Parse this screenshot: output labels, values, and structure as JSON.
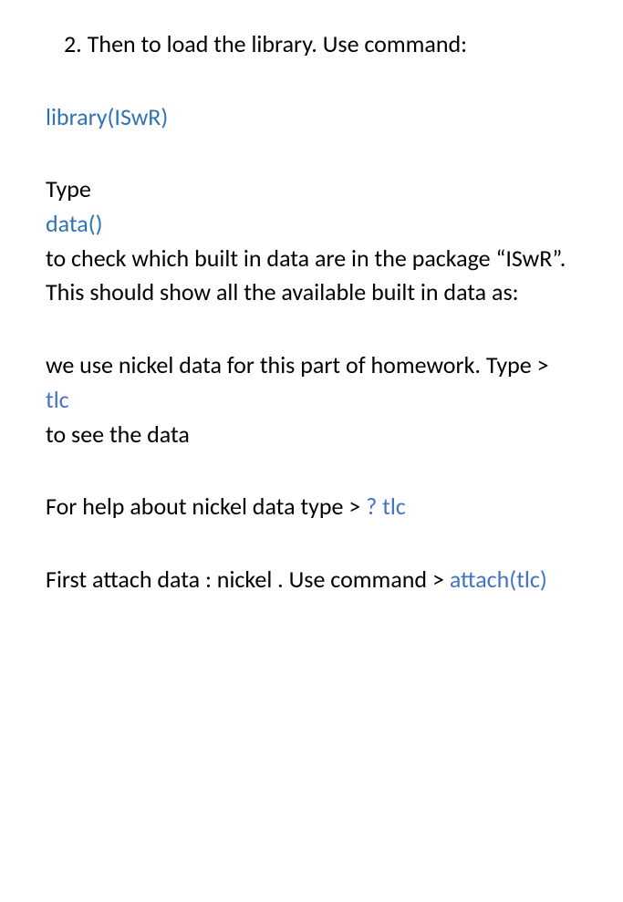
{
  "list": {
    "number": "2.",
    "text": "Then to load the library. Use command:"
  },
  "code": {
    "library": "library(ISwR)",
    "data": "data()",
    "tlc": "tlc",
    "help_tlc": "? tlc",
    "attach_tlc": "attach(tlc)"
  },
  "text": {
    "type_label": "Type",
    "check_builtin": "to check which built in data are in the package “ISwR”.",
    "show_available": "This should show all the available built in data as:",
    "use_nickel_prefix": "we use nickel  data for this part of homework. Type > ",
    "to_see_data": "to see the data",
    "help_prefix": "For help about nickel data type  > ",
    "attach_prefix": "First attach data : nickel .  Use command > "
  }
}
